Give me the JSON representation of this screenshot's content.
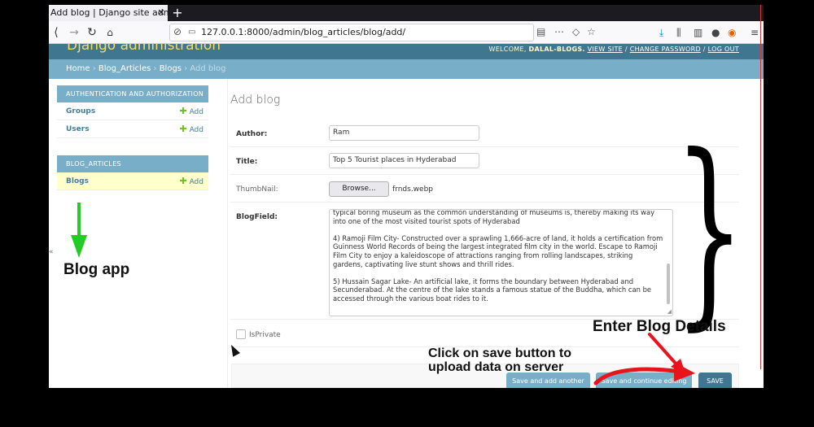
{
  "browser": {
    "tab_title": "Add blog | Django site admin",
    "url": "127.0.0.1:8000/admin/blog_articles/blog/add/"
  },
  "django": {
    "brand": "Django administration",
    "welcome": "WELCOME,",
    "username": "DALAL-BLOGS.",
    "view_site": "VIEW SITE",
    "change_password": "CHANGE PASSWORD",
    "logout": "LOG OUT",
    "sep": "/"
  },
  "breadcrumbs": {
    "home": "Home",
    "app": "Blog_Articles",
    "model": "Blogs",
    "current": "Add blog",
    "sep": "›"
  },
  "sidebar": {
    "modules": [
      {
        "caption": "AUTHENTICATION AND AUTHORIZATION",
        "items": [
          {
            "label": "Groups",
            "add": "Add"
          },
          {
            "label": "Users",
            "add": "Add"
          }
        ]
      },
      {
        "caption": "BLOG_ARTICLES",
        "items": [
          {
            "label": "Blogs",
            "add": "Add"
          }
        ]
      }
    ],
    "collapse": "«"
  },
  "main": {
    "title": "Add blog",
    "fields": {
      "author_label": "Author:",
      "author_value": "Ram",
      "title_label": "Title:",
      "title_value": "Top 5 Tourist places in Hyderabad",
      "thumb_label": "ThumbNail:",
      "browse": "Browse...",
      "file": "frnds.webp",
      "blog_label": "BlogField:",
      "blog_text": "typical boring museum as the common understanding of museums is, thereby making its way into one of the most visited tourist spots of Hyderabad\n\n4) Ramoji Film City- Constructed over a sprawling 1,666-acre of land, it holds a certification from Guinness World Records of being the largest integrated film city in the world. Escape to Ramoji Film City to enjoy a kaleidoscope of attractions ranging from rolling landscapes, striking gardens, captivating live stunt shows and thrill rides.\n\n5) Hussain Sagar Lake- An artificial lake, it forms the boundary between Hyderabad and Secunderabad. At the centre of the lake stands a famous statue of the Buddha, which can be accessed through the various boat rides to it.",
      "private_label": "IsPrivate",
      "private_checked": false
    },
    "buttons": {
      "save_add": "Save and add another",
      "save_continue": "Save and continue editing",
      "save": "SAVE"
    }
  },
  "annotations": {
    "blog_app": "Blog app",
    "enter_details": "Enter Blog Details",
    "save_line1": "Click on save button to",
    "save_line2": "upload data on server"
  },
  "colors": {
    "header": "#417690",
    "breadcrumb": "#79aec8",
    "brand": "#f5dd5d",
    "add_plus": "#70bf2b",
    "green_arrow": "#22cc22",
    "red_arrow": "#e8141c"
  }
}
